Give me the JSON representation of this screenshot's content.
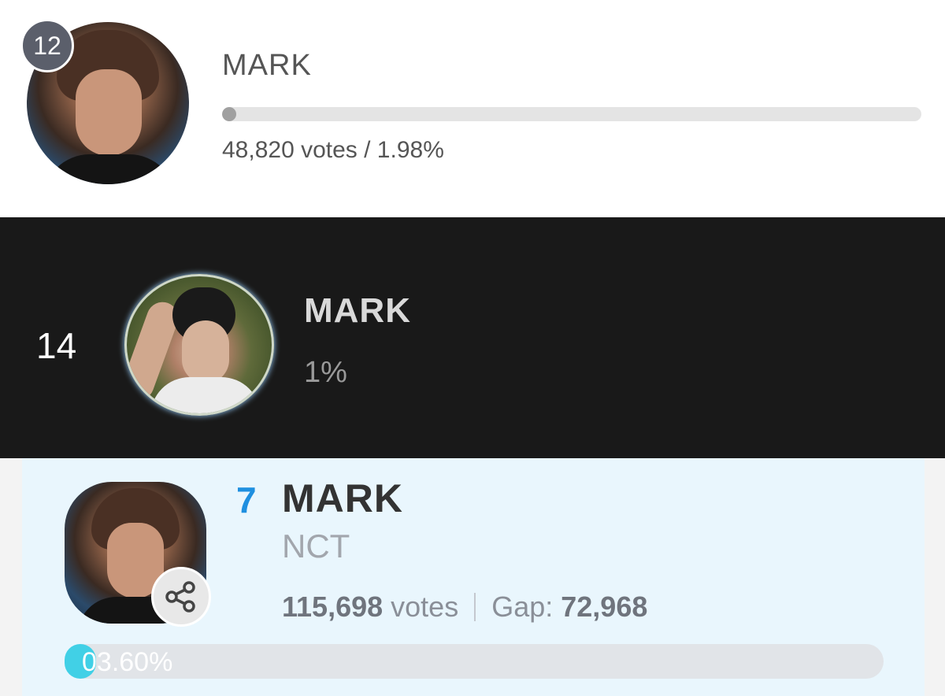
{
  "card_top": {
    "rank": "12",
    "name": "MARK",
    "progress_fraction": 0.0198,
    "stats": "48,820 votes / 1.98%",
    "colors": {
      "background": "#ffffff",
      "bar_fill": "#a0a0a0",
      "badge": "#5b5f6b"
    }
  },
  "card_middle": {
    "rank": "14",
    "name": "MARK",
    "percent": "1%",
    "colors": {
      "background": "#191919"
    }
  },
  "card_bottom": {
    "rank": "7",
    "name": "MARK",
    "group": "NCT",
    "votes_number": "115,698",
    "votes_unit": "votes",
    "gap_label": "Gap:",
    "gap_number": "72,968",
    "percent_label": "03.60%",
    "progress_fraction": 0.036,
    "share_icon": "share-icon",
    "colors": {
      "background": "#e9f6fd",
      "rank": "#1e8fe0",
      "bar_fill": "#41d0e6"
    }
  }
}
